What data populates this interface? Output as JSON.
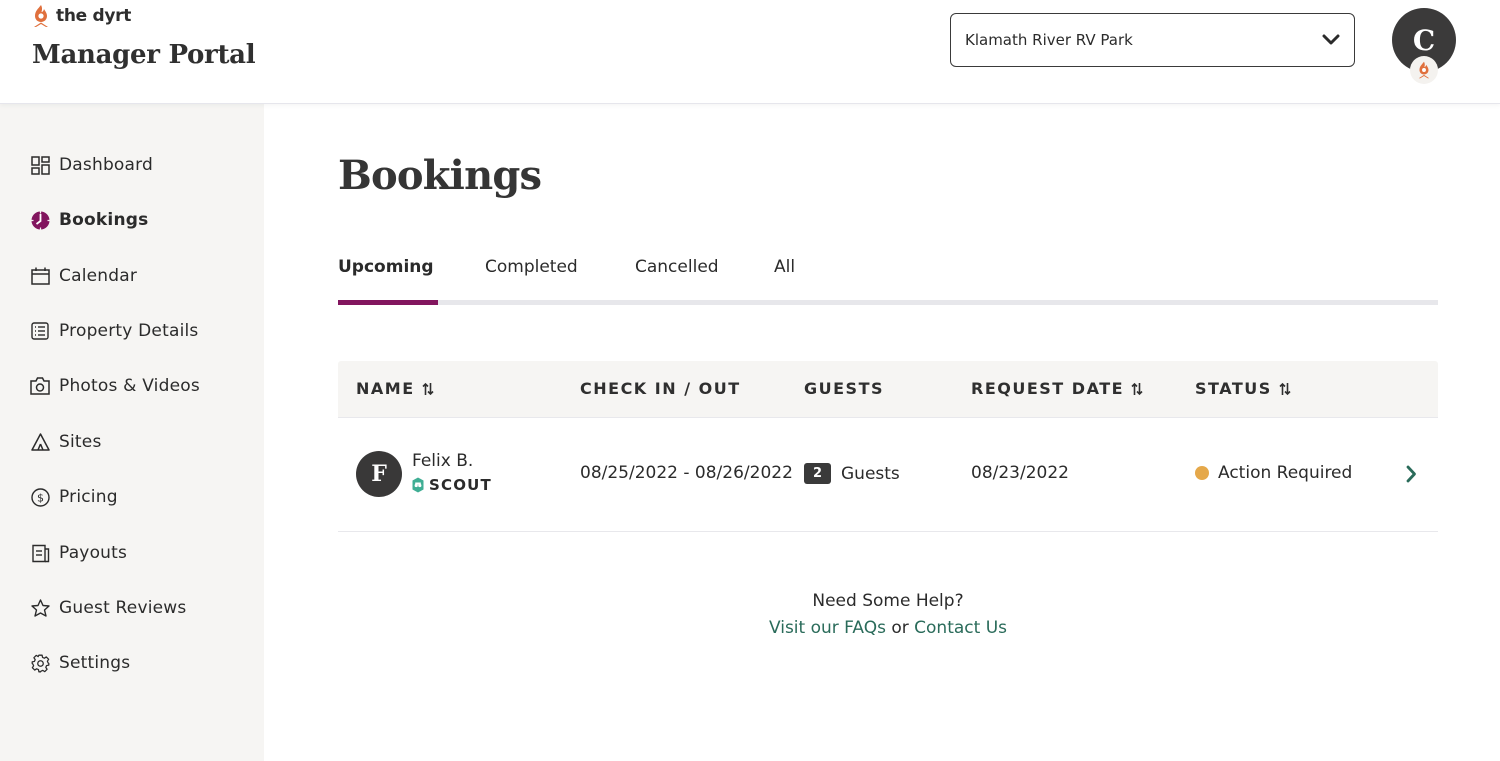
{
  "header": {
    "brand_name": "the dyrt",
    "portal_title": "Manager Portal",
    "property_selector": {
      "value": "Klamath River RV Park",
      "icon": "chevron-down-icon"
    },
    "user_avatar": {
      "initial": "C",
      "badge_icon": "campfire-icon"
    }
  },
  "colors": {
    "accent": "#82155e",
    "brand_orange": "#e0703d",
    "link_green": "#2a6b5a",
    "status_pending": "#e5a84a",
    "scout_teal": "#3fae94",
    "sidebar_bg": "#f6f5f3"
  },
  "sidebar": {
    "items": [
      {
        "label": "Dashboard",
        "icon": "dashboard-grid-icon",
        "active": false
      },
      {
        "label": "Bookings",
        "icon": "bookings-clock-icon",
        "active": true
      },
      {
        "label": "Calendar",
        "icon": "calendar-icon",
        "active": false
      },
      {
        "label": "Property Details",
        "icon": "list-icon",
        "active": false
      },
      {
        "label": "Photos & Videos",
        "icon": "camera-icon",
        "active": false
      },
      {
        "label": "Sites",
        "icon": "tent-icon",
        "active": false
      },
      {
        "label": "Pricing",
        "icon": "dollar-circle-icon",
        "active": false
      },
      {
        "label": "Payouts",
        "icon": "receipt-icon",
        "active": false
      },
      {
        "label": "Guest Reviews",
        "icon": "star-icon",
        "active": false
      },
      {
        "label": "Settings",
        "icon": "gear-icon",
        "active": false
      }
    ]
  },
  "main": {
    "title": "Bookings",
    "tabs": [
      {
        "label": "Upcoming",
        "active": true
      },
      {
        "label": "Completed",
        "active": false
      },
      {
        "label": "Cancelled",
        "active": false
      },
      {
        "label": "All",
        "active": false
      }
    ],
    "table": {
      "columns": [
        {
          "label": "NAME",
          "sortable": true
        },
        {
          "label": "CHECK IN / OUT",
          "sortable": false
        },
        {
          "label": "GUESTS",
          "sortable": false
        },
        {
          "label": "REQUEST DATE",
          "sortable": true
        },
        {
          "label": "STATUS",
          "sortable": true
        }
      ],
      "rows": [
        {
          "avatar_initial": "F",
          "name": "Felix B.",
          "badge": "SCOUT",
          "check_in_out": "08/25/2022 - 08/26/2022",
          "guest_count": "2",
          "guests_label": "Guests",
          "request_date": "08/23/2022",
          "status": "Action Required"
        }
      ]
    },
    "help": {
      "title": "Need Some Help?",
      "faq_link": "Visit our FAQs",
      "connector": " or ",
      "contact_link": "Contact Us"
    }
  }
}
